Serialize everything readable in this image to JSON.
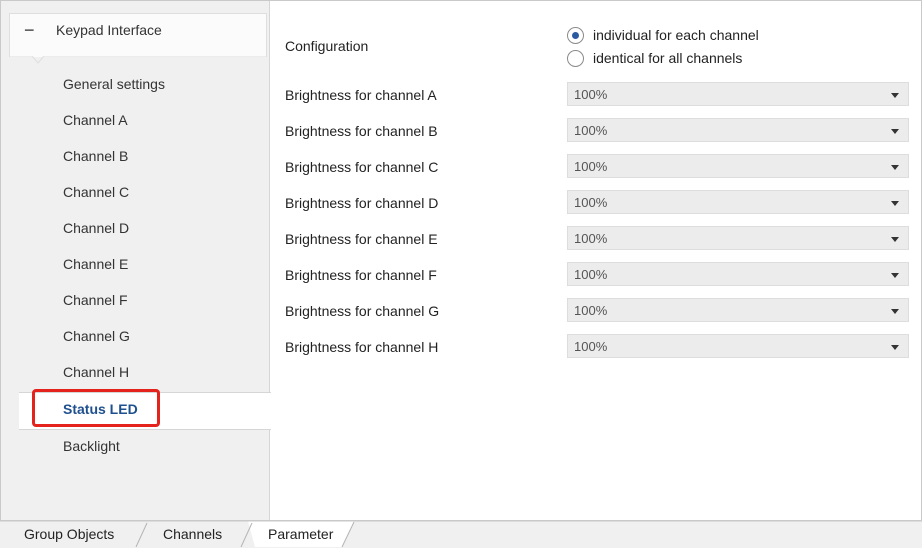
{
  "sidebar": {
    "root_label": "Keypad Interface",
    "items": [
      {
        "label": "General settings"
      },
      {
        "label": "Channel A"
      },
      {
        "label": "Channel B"
      },
      {
        "label": "Channel C"
      },
      {
        "label": "Channel D"
      },
      {
        "label": "Channel E"
      },
      {
        "label": "Channel F"
      },
      {
        "label": "Channel G"
      },
      {
        "label": "Channel H"
      },
      {
        "label": "Status LED",
        "selected": true
      },
      {
        "label": "Backlight"
      }
    ]
  },
  "config": {
    "label": "Configuration",
    "options": [
      {
        "label": "individual for each channel",
        "checked": true
      },
      {
        "label": "identical for all channels",
        "checked": false
      }
    ]
  },
  "rows": [
    {
      "label": "Brightness for channel A",
      "value": "100%"
    },
    {
      "label": "Brightness for channel B",
      "value": "100%"
    },
    {
      "label": "Brightness for channel C",
      "value": "100%"
    },
    {
      "label": "Brightness for channel D",
      "value": "100%"
    },
    {
      "label": "Brightness for channel E",
      "value": "100%"
    },
    {
      "label": "Brightness for channel F",
      "value": "100%"
    },
    {
      "label": "Brightness for channel G",
      "value": "100%"
    },
    {
      "label": "Brightness for channel H",
      "value": "100%"
    }
  ],
  "tabs": [
    {
      "label": "Group Objects"
    },
    {
      "label": "Channels"
    },
    {
      "label": "Parameter",
      "active": true
    }
  ],
  "colors": {
    "highlight_box": "#e5231d",
    "selected_text": "#1e4f8e",
    "radio_accent": "#2c5aa0"
  }
}
